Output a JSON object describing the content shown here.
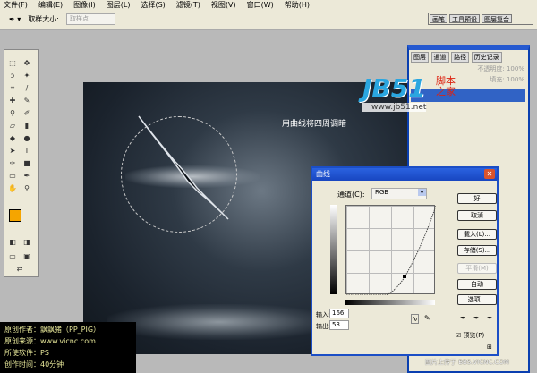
{
  "menu": [
    "文件(F)",
    "编辑(E)",
    "图像(I)",
    "图层(L)",
    "选择(S)",
    "滤镜(T)",
    "视图(V)",
    "窗口(W)",
    "帮助(H)"
  ],
  "options": {
    "label": "取样大小:",
    "value": "取样点"
  },
  "palette_well": [
    "画笔",
    "工具预设",
    "图层复合"
  ],
  "layers_panel": {
    "tabs": [
      "图层",
      "通道",
      "路径",
      "历史记录"
    ],
    "opacity": "不透明度: 100%",
    "fill": "填充: 100%"
  },
  "canvas": {
    "note": "用曲线将四周调暗"
  },
  "curves": {
    "title": "曲线",
    "channel_label": "通道(C):",
    "channel_value": "RGB",
    "ok": "好",
    "cancel": "取消",
    "load": "载入(L)...",
    "save": "存储(S)...",
    "smooth": "平滑(M)",
    "auto": "自动",
    "options": "选项...",
    "input_label": "输入:",
    "input_value": "166",
    "output_label": "输出:",
    "output_value": "53",
    "preview": "预览(P)"
  },
  "credit": [
    "原创作者：飘飘猪（PP_PIG）",
    "原创来源：www.vicnc.com",
    "所使软件：PS",
    "创作时间：40分钟"
  ],
  "watermark": {
    "logo": "JB51",
    "cn": "脚本之家",
    "url": "www.jb51.net"
  },
  "footer": "图片上传于 BBS.VICNC.COM",
  "colors": {
    "accent": "#f5a500",
    "titlebar": "#1846c0"
  }
}
